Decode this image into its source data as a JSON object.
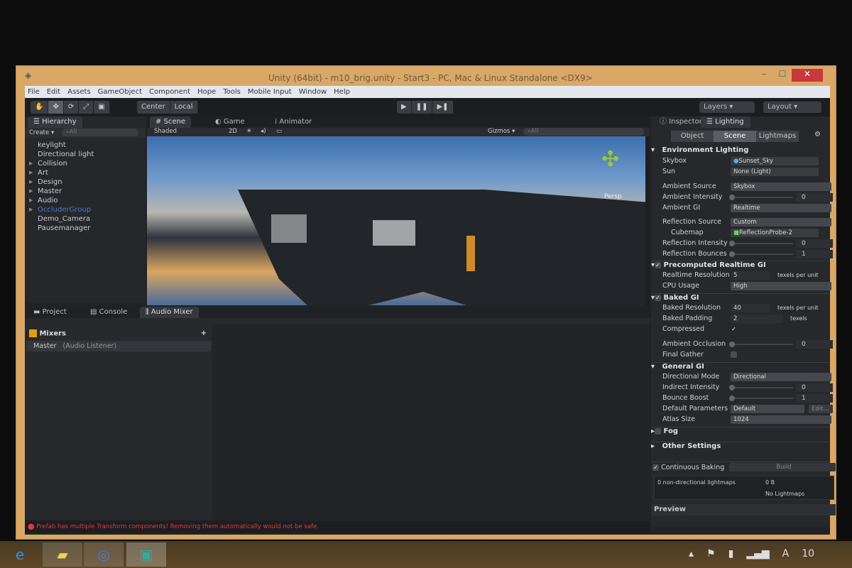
{
  "window": {
    "title": "Unity (64bit) - m10_brig.unity - Start3 - PC, Mac & Linux Standalone <DX9>",
    "minimize": "–",
    "maximize": "☐",
    "close": "✕"
  },
  "menu": [
    "File",
    "Edit",
    "Assets",
    "GameObject",
    "Component",
    "Hope",
    "Tools",
    "Mobile Input",
    "Window",
    "Help"
  ],
  "toolbar": {
    "tools": [
      "✋",
      "✥",
      "⟳",
      "⤢",
      "▣"
    ],
    "center": "Center",
    "local": "Local",
    "play": "▶",
    "pause": "❚❚",
    "step": "▶❚",
    "layers": "Layers",
    "layout": "Layout"
  },
  "hierarchy": {
    "tab": "Hierarchy",
    "create": "Create",
    "search_placeholder": "All",
    "items": [
      {
        "label": "keylight",
        "expandable": false
      },
      {
        "label": "Directional light",
        "expandable": false
      },
      {
        "label": "Collision",
        "expandable": true
      },
      {
        "label": "Art",
        "expandable": true
      },
      {
        "label": "Design",
        "expandable": true
      },
      {
        "label": "Master",
        "expandable": true
      },
      {
        "label": "Audio",
        "expandable": true
      },
      {
        "label": "OccluderGroup",
        "expandable": true
      },
      {
        "label": "Demo_Camera",
        "expandable": false
      },
      {
        "label": "Pausemanager",
        "expandable": false
      }
    ]
  },
  "scene": {
    "tabs": [
      "Scene",
      "Game",
      "Animator"
    ],
    "shading": "Shaded",
    "mode_2d": "2D",
    "gizmos": "Gizmos",
    "search_placeholder": "All",
    "persp": "Persp"
  },
  "bottom": {
    "tabs": [
      "Project",
      "Console",
      "Audio Mixer"
    ],
    "mixers_label": "Mixers",
    "add": "+",
    "master": "Master",
    "master_note": "(Audio Listener)"
  },
  "inspector": {
    "tabs": [
      "Inspector",
      "Lighting"
    ],
    "subtabs": [
      "Object",
      "Scene",
      "Lightmaps"
    ],
    "env_title": "Environment Lighting",
    "skybox_label": "Skybox",
    "skybox": "Sunset_Sky",
    "sun_label": "Sun",
    "sun": "None (Light)",
    "amb_source_label": "Ambient Source",
    "amb_source": "Skybox",
    "amb_int_label": "Ambient Intensity",
    "amb_int": "0",
    "amb_gi_label": "Ambient GI",
    "amb_gi": "Realtime",
    "refl_source_label": "Reflection Source",
    "refl_source": "Custom",
    "cubemap_label": "Cubemap",
    "cubemap": "ReflectionProbe-2",
    "refl_int_label": "Reflection Intensity",
    "refl_int": "0",
    "refl_bounce_label": "Reflection Bounces",
    "refl_bounce": "1",
    "prt_title": "Precomputed Realtime GI",
    "rt_res_label": "Realtime Resolution",
    "rt_res": "5",
    "texels_per_unit": "texels per unit",
    "cpu_label": "CPU Usage",
    "cpu": "High",
    "baked_title": "Baked GI",
    "baked_res_label": "Baked Resolution",
    "baked_res": "40",
    "baked_pad_label": "Baked Padding",
    "baked_pad": "2",
    "texels": "texels",
    "compressed_label": "Compressed",
    "ao_label": "Ambient Occlusion",
    "ao": "0",
    "fg_label": "Final Gather",
    "general_title": "General GI",
    "dir_mode_label": "Directional Mode",
    "dir_mode": "Directional",
    "ind_int_label": "Indirect Intensity",
    "ind_int": "0",
    "bounce_label": "Bounce Boost",
    "bounce": "1",
    "defparams_label": "Default Parameters",
    "defparams": "Default",
    "edit": "Edit...",
    "atlas_label": "Atlas Size",
    "atlas": "1024",
    "fog_title": "Fog",
    "other_title": "Other Settings",
    "continuous_label": "Continuous Baking",
    "build": "Build",
    "lightmaps_info": "0 non-directional lightmaps",
    "size": "0 B",
    "no_lightmaps": "No Lightmaps",
    "preview": "Preview"
  },
  "status": {
    "error": "Prefab has multiple Transform components! Removing them automatically would not be safe."
  },
  "taskbar": {
    "clock": "10"
  }
}
